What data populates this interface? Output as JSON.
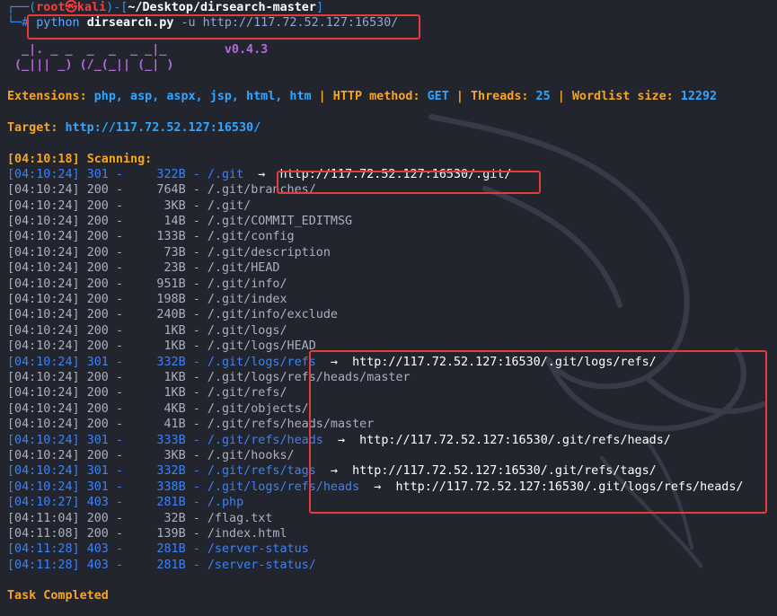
{
  "prompt": {
    "prefix_open": "┌──(",
    "user": "root㉿kali",
    "prefix_mid": ")-[",
    "path": "~/Desktop/dirsearch-master",
    "prefix_close": "]",
    "prompt2": "└─#",
    "command_prog": "python",
    "command_script": "dirsearch.py",
    "command_args": "-u http://117.72.52.127:16530/"
  },
  "logo": {
    "line1": "  _|. _ _  _  _  _ _|_",
    "line2": " (_||| _) (/_(_|| (_| )",
    "version": "v0.4.3"
  },
  "config": {
    "extensions_label": "Extensions:",
    "extensions_value": "php, asp, aspx, jsp, html, htm",
    "method_label": "HTTP method:",
    "method_value": "GET",
    "threads_label": "Threads:",
    "threads_value": "25",
    "wordlist_label": "Wordlist size:",
    "wordlist_value": "12292",
    "sep": "|"
  },
  "target": {
    "label": "Target:",
    "value": "http://117.72.52.127:16530/"
  },
  "scan_start": {
    "time": "[04:10:18]",
    "text": "Scanning:"
  },
  "results": [
    {
      "time": "[04:10:24]",
      "code": "301",
      "size": "322B",
      "path": "/.git",
      "redirect": "http://117.72.52.127:16530/.git/"
    },
    {
      "time": "[04:10:24]",
      "code": "200",
      "size": "764B",
      "path": "/.git/branches/",
      "redirect": ""
    },
    {
      "time": "[04:10:24]",
      "code": "200",
      "size": "3KB",
      "path": "/.git/",
      "redirect": ""
    },
    {
      "time": "[04:10:24]",
      "code": "200",
      "size": "14B",
      "path": "/.git/COMMIT_EDITMSG",
      "redirect": ""
    },
    {
      "time": "[04:10:24]",
      "code": "200",
      "size": "133B",
      "path": "/.git/config",
      "redirect": ""
    },
    {
      "time": "[04:10:24]",
      "code": "200",
      "size": "73B",
      "path": "/.git/description",
      "redirect": ""
    },
    {
      "time": "[04:10:24]",
      "code": "200",
      "size": "23B",
      "path": "/.git/HEAD",
      "redirect": ""
    },
    {
      "time": "[04:10:24]",
      "code": "200",
      "size": "951B",
      "path": "/.git/info/",
      "redirect": ""
    },
    {
      "time": "[04:10:24]",
      "code": "200",
      "size": "198B",
      "path": "/.git/index",
      "redirect": ""
    },
    {
      "time": "[04:10:24]",
      "code": "200",
      "size": "240B",
      "path": "/.git/info/exclude",
      "redirect": ""
    },
    {
      "time": "[04:10:24]",
      "code": "200",
      "size": "1KB",
      "path": "/.git/logs/",
      "redirect": ""
    },
    {
      "time": "[04:10:24]",
      "code": "200",
      "size": "1KB",
      "path": "/.git/logs/HEAD",
      "redirect": ""
    },
    {
      "time": "[04:10:24]",
      "code": "301",
      "size": "332B",
      "path": "/.git/logs/refs",
      "redirect": "http://117.72.52.127:16530/.git/logs/refs/"
    },
    {
      "time": "[04:10:24]",
      "code": "200",
      "size": "1KB",
      "path": "/.git/logs/refs/heads/master",
      "redirect": ""
    },
    {
      "time": "[04:10:24]",
      "code": "200",
      "size": "1KB",
      "path": "/.git/refs/",
      "redirect": ""
    },
    {
      "time": "[04:10:24]",
      "code": "200",
      "size": "4KB",
      "path": "/.git/objects/",
      "redirect": ""
    },
    {
      "time": "[04:10:24]",
      "code": "200",
      "size": "41B",
      "path": "/.git/refs/heads/master",
      "redirect": ""
    },
    {
      "time": "[04:10:24]",
      "code": "301",
      "size": "333B",
      "path": "/.git/refs/heads",
      "redirect": "http://117.72.52.127:16530/.git/refs/heads/"
    },
    {
      "time": "[04:10:24]",
      "code": "200",
      "size": "3KB",
      "path": "/.git/hooks/",
      "redirect": ""
    },
    {
      "time": "[04:10:24]",
      "code": "301",
      "size": "332B",
      "path": "/.git/refs/tags",
      "redirect": "http://117.72.52.127:16530/.git/refs/tags/"
    },
    {
      "time": "[04:10:24]",
      "code": "301",
      "size": "338B",
      "path": "/.git/logs/refs/heads",
      "redirect": "http://117.72.52.127:16530/.git/logs/refs/heads/"
    },
    {
      "time": "[04:10:27]",
      "code": "403",
      "size": "281B",
      "path": "/.php",
      "redirect": ""
    },
    {
      "time": "[04:11:04]",
      "code": "200",
      "size": "32B",
      "path": "/flag.txt",
      "redirect": ""
    },
    {
      "time": "[04:11:08]",
      "code": "200",
      "size": "139B",
      "path": "/index.html",
      "redirect": ""
    },
    {
      "time": "[04:11:28]",
      "code": "403",
      "size": "281B",
      "path": "/server-status",
      "redirect": ""
    },
    {
      "time": "[04:11:28]",
      "code": "403",
      "size": "281B",
      "path": "/server-status/",
      "redirect": ""
    }
  ],
  "arrow": "→",
  "dash": "-",
  "completed": "Task Completed",
  "colors": {
    "background": "#23252e",
    "highlight": "#e53b3b",
    "orange": "#f5a524",
    "blue": "#2fa6ff",
    "purple": "#b46bd8"
  }
}
